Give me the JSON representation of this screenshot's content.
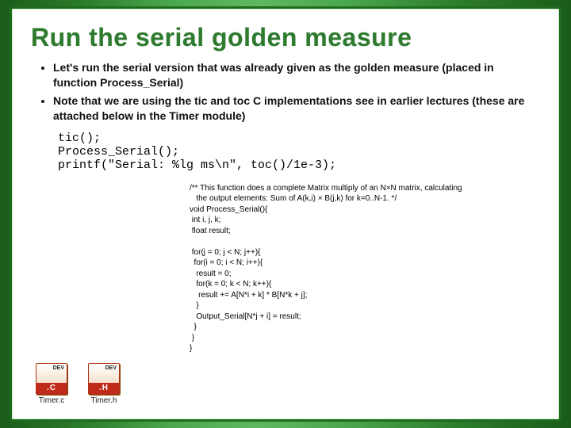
{
  "title": "Run the serial golden measure",
  "bullets": [
    "Let's run the serial version that was already given as the golden measure (placed in function Process_Serial)",
    "Note that we are using the tic and toc C implementations see in earlier lectures (these are attached below in the Timer module)"
  ],
  "code1": "  tic();\n  Process_Serial();\n  printf(\"Serial: %lg ms\\n\", toc()/1e-3);",
  "code2": "/** This function does a complete Matrix multiply of an N×N matrix, calculating\n   the output elements: Sum of A(k,i) × B(j,k) for k=0..N-1. */\nvoid Process_Serial(){\n int i, j, k;\n float result;\n\n for(j = 0; j < N; j++){\n  for(i = 0; i < N; i++){\n   result = 0;\n   for(k = 0; k < N; k++){\n    result += A[N*i + k] * B[N*k + j];\n   }\n   Output_Serial[N*j + i] = result;\n  }\n }\n}",
  "files": [
    {
      "ext": ".C",
      "label": "Timer.c",
      "brand": "DEV"
    },
    {
      "ext": ".H",
      "label": "Timer.h",
      "brand": "DEV"
    }
  ]
}
